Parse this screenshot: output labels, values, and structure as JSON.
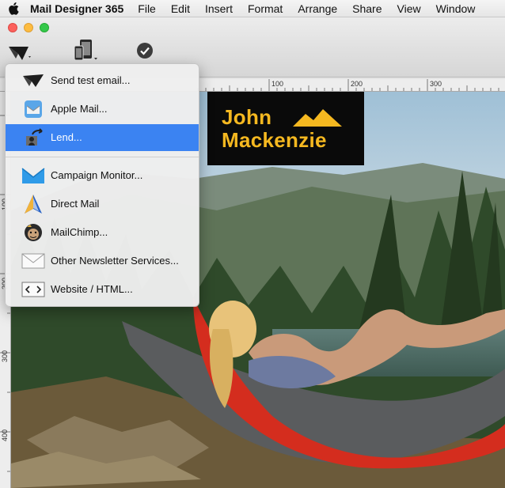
{
  "menubar": {
    "app_name": "Mail Designer 365",
    "items": [
      "File",
      "Edit",
      "Insert",
      "Format",
      "Arrange",
      "Share",
      "View",
      "Window"
    ]
  },
  "ruler": {
    "top_labels": [
      "100",
      "200",
      "300"
    ],
    "left_labels": [
      "100",
      "200",
      "300",
      "400"
    ]
  },
  "dropdown": {
    "items": [
      {
        "label": "Send test email...",
        "icon": "paper-plane-icon"
      },
      {
        "label": "Apple Mail...",
        "icon": "apple-mail-icon"
      },
      {
        "label": "Lend...",
        "icon": "lend-icon",
        "selected": true
      },
      {
        "label": "Campaign Monitor...",
        "icon": "campaign-monitor-icon"
      },
      {
        "label": "Direct Mail",
        "icon": "direct-mail-icon"
      },
      {
        "label": "MailChimp...",
        "icon": "mailchimp-icon"
      },
      {
        "label": "Other Newsletter Services...",
        "icon": "envelope-icon"
      },
      {
        "label": "Website / HTML...",
        "icon": "code-icon"
      }
    ]
  },
  "logo": {
    "line1": "John",
    "line2": "Mackenzie"
  },
  "colors": {
    "selection": "#3b83f2",
    "logo_yellow": "#f5b820",
    "logo_bg": "#0a0a0a"
  }
}
